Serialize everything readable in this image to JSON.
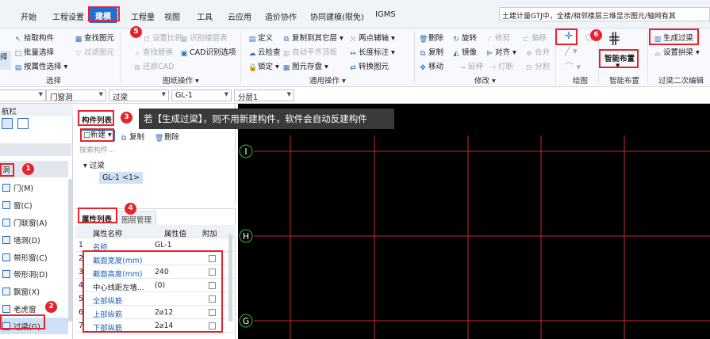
{
  "menu": [
    "开始",
    "工程设置",
    "建模",
    "工程量",
    "视图",
    "工具",
    "云应用",
    "造价协作",
    "协同建模(限免)",
    "IGMS"
  ],
  "hint_text": "土建计量GTJ中，全楼/相邻楼层三维显示图元/轴网有其",
  "ribbon": {
    "select_group": {
      "big_button": "择",
      "items": [
        "拾取构件",
        "批量选择",
        "按属性选择",
        "查找图元",
        "过滤图元"
      ],
      "label": "选择"
    },
    "drawing_ops": {
      "items": [
        "设置比例",
        "识别楼层表",
        "查找替换",
        "CAD识别选项",
        "还原CAD"
      ],
      "label": "图纸操作 ▾"
    },
    "common_ops": {
      "items": [
        "定义",
        "复制到其它层",
        "两点辅轴",
        "云检查",
        "自动平齐顶板",
        "长度标注",
        "锁定",
        "图元存盘",
        "转换图元"
      ],
      "label": "通用操作 ▾"
    },
    "modify": {
      "items": [
        "删除",
        "旋转",
        "修剪",
        "偏移",
        "复制",
        "镜像",
        "对齐",
        "合并",
        "移动",
        "延伸",
        "打断",
        "分割"
      ],
      "label": "修改 ▾"
    },
    "draw": {
      "label": "绘图"
    },
    "smart_layout": {
      "button": "智能布置",
      "label": "智能布置"
    },
    "lintel_edit": {
      "items": [
        "生成过梁",
        "设置拱梁"
      ],
      "label": "过梁二次编辑"
    }
  },
  "selectors": [
    "门窗洞",
    "过梁",
    "GL-1",
    "分层1"
  ],
  "nav": {
    "header": "航栏",
    "group": "洞",
    "items": [
      "门(M)",
      "窗(C)",
      "门联窗(A)",
      "墙洞(D)",
      "带形窗(C)",
      "带形洞(D)",
      "飘窗(X)",
      "老虎窗",
      "过梁(G)"
    ]
  },
  "component_list": {
    "tab_label": "构件列表",
    "new_button": "新建",
    "copy_button": "复制",
    "delete_button": "删除",
    "search_placeholder": "搜索构件...",
    "tree_root": "过梁",
    "tree_item": "GL-1 <1>"
  },
  "property_list": {
    "tab_on": "属性列表",
    "tab_off": "图层管理",
    "headers": [
      "属性名称",
      "属性值",
      "附加"
    ],
    "rows": [
      {
        "n": "1",
        "name": "名称",
        "value": "GL-1"
      },
      {
        "n": "2",
        "name": "截面宽度(mm)",
        "value": ""
      },
      {
        "n": "3",
        "name": "截面高度(mm)",
        "value": "240"
      },
      {
        "n": "4",
        "name": "中心线距左墙...",
        "value": "(0)"
      },
      {
        "n": "5",
        "name": "全部纵筋",
        "value": ""
      },
      {
        "n": "6",
        "name": "上部纵筋",
        "value": "2⌀12"
      },
      {
        "n": "7",
        "name": "下部纵筋",
        "value": "2⌀14"
      }
    ]
  },
  "tooltip": "若【生成过梁】，则不用新建构件，软件会自动反建构件",
  "axis_labels": [
    "I",
    "H",
    "G"
  ],
  "badges": [
    "1",
    "2",
    "3",
    "4",
    "5",
    "6"
  ],
  "colors": {
    "accent": "#1e70d4",
    "annotation": "#e8222c",
    "grid_line": "#c8282e",
    "axis_circle": "#2fbf3a"
  }
}
